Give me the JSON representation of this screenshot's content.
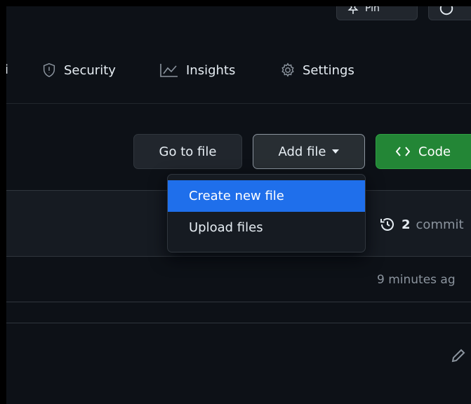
{
  "header": {
    "pin_label": "Pin",
    "partial_button_label": ""
  },
  "tabs": [
    {
      "label": "i",
      "icon": "tab-left-partial"
    },
    {
      "label": "Security",
      "icon": "shield-icon"
    },
    {
      "label": "Insights",
      "icon": "graph-icon"
    },
    {
      "label": "Settings",
      "icon": "gear-icon"
    }
  ],
  "toolbar": {
    "go_to_file": "Go to file",
    "add_file": "Add file",
    "code": "Code"
  },
  "dropdown": {
    "items": [
      {
        "label": "Create new file",
        "selected": true
      },
      {
        "label": "Upload files",
        "selected": false
      }
    ]
  },
  "repo": {
    "commits_count": "2",
    "commits_label": "commit",
    "last_updated": "9 minutes ag"
  },
  "colors": {
    "background": "#0d1117",
    "primary_green": "#238636",
    "menu_highlight": "#1f6feb"
  }
}
